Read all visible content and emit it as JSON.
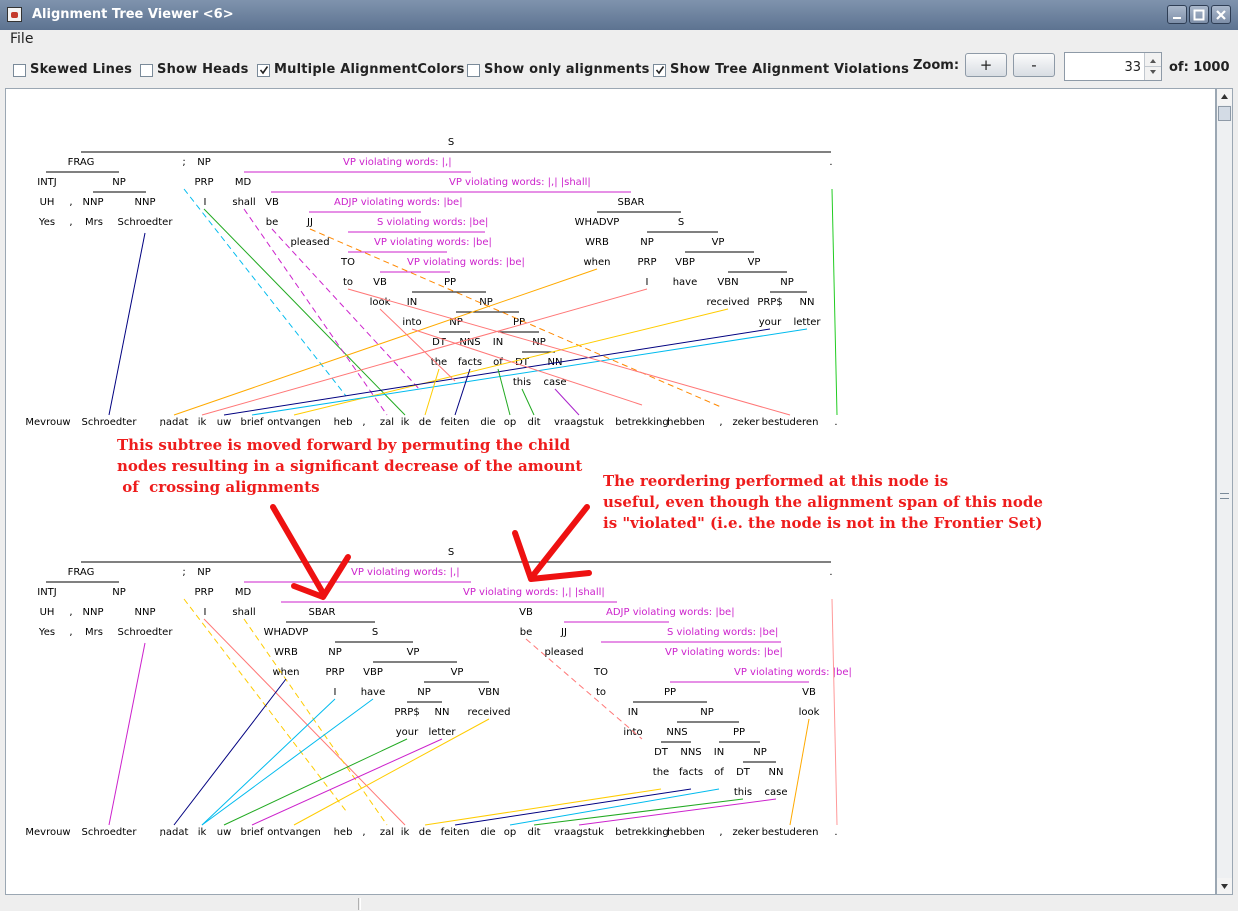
{
  "window": {
    "title": "Alignment Tree Viewer <6>"
  },
  "menu": {
    "file": "File"
  },
  "toolbar": {
    "options": [
      {
        "label": "Skewed Lines",
        "checked": false
      },
      {
        "label": "Show Heads",
        "checked": false
      },
      {
        "label": "Multiple AlignmentColors",
        "checked": true
      },
      {
        "label": "Show only alignments",
        "checked": false
      },
      {
        "label": "Show Tree Alignment Violations",
        "checked": true
      }
    ],
    "zoom_label": "Zoom:",
    "zoom_in": "+",
    "zoom_out": "-",
    "index_value": "33",
    "of_label": "of: 1000"
  },
  "colors": {
    "violation": "#cc22cc",
    "annotation": "#ee1c1c",
    "tree": "#000000"
  },
  "tree1": {
    "root": "S",
    "nodes": [
      "FRAG",
      ";",
      "NP",
      "INTJ",
      "NNP",
      "NP",
      "UH",
      ",",
      "NNP",
      "NNP",
      "PRP",
      "MD",
      "VB",
      "JJ",
      "TO",
      "VB",
      "IN",
      "DT",
      "NNS",
      "IN",
      "DT",
      "NN",
      "NP",
      "PP",
      "NP",
      "PP",
      "NP",
      "SBAR",
      "WHADVP",
      "S",
      "WRB",
      "NP",
      "VP",
      "PRP",
      "VBP",
      "VP",
      "VBN",
      "NP",
      "PRP$",
      "NN",
      "ADJP"
    ],
    "violations": [
      {
        "label": "VP",
        "text": "violating words:  |,|"
      },
      {
        "label": "VP",
        "text": "violating words:  |,| |shall|"
      },
      {
        "label": "ADJP",
        "text": "violating words:  |be|"
      },
      {
        "label": "S",
        "text": "violating words:  |be|"
      },
      {
        "label": "VP",
        "text": "violating words:  |be|"
      },
      {
        "label": "VP",
        "text": "violating words:  |be|"
      }
    ],
    "words": [
      "Yes",
      ",",
      "Mrs",
      "Schroedter",
      ";",
      "I",
      "shall",
      "be",
      "pleased",
      "to",
      "look",
      "into",
      "the",
      "facts",
      "of",
      "this",
      "case",
      "when",
      "I",
      "have",
      "received",
      "your",
      "letter",
      "."
    ]
  },
  "tree2": {
    "root": "S",
    "nodes": [
      "FRAG",
      ";",
      "NP",
      "INTJ",
      "NP",
      "UH",
      ",",
      "NNP",
      "NNP",
      "PRP",
      "MD",
      "SBAR",
      "WHADVP",
      "S",
      "WRB",
      "NP",
      "VP",
      "PRP",
      "VBP",
      "VP",
      "NP",
      "VBN",
      "PRP$",
      "NN",
      "VB",
      "ADJP",
      "JJ",
      "S",
      "TO",
      "VP",
      "PP",
      "VB",
      "IN",
      "NP",
      "DT",
      "NNS",
      "PP",
      "IN",
      "NP",
      "DT",
      "NN"
    ],
    "violations": [
      {
        "label": "VP",
        "text": "violating words:  |,|"
      },
      {
        "label": "VP",
        "text": "violating words:  |,| |shall|"
      },
      {
        "label": "ADJP",
        "text": "violating words:  |be|"
      },
      {
        "label": "S",
        "text": "violating words:  |be|"
      },
      {
        "label": "VP",
        "text": "violating words:  |be|"
      },
      {
        "label": "VP",
        "text": "violating words:  |be|"
      }
    ],
    "words": [
      "Yes",
      ",",
      "Mrs",
      "Schroedter",
      ";",
      "I",
      "shall",
      "when",
      "I",
      "have",
      "your",
      "letter",
      "received",
      "be",
      "pleased",
      "to",
      "into",
      "the",
      "facts",
      "of",
      "this",
      "case",
      "look",
      "."
    ]
  },
  "target_sentence": [
    "Mevrouw",
    "Schroedter",
    ",",
    "nadat",
    "ik",
    "uw",
    "brief",
    "ontvangen",
    "heb",
    ",",
    "zal",
    "ik",
    "de",
    "feiten",
    "die",
    "op",
    "dit",
    "vraagstuk",
    "betrekking",
    "hebben",
    ",",
    "zeker",
    "bestuderen",
    "."
  ],
  "annotations": {
    "left": "This subtree is moved forward by permuting the child\nnodes resulting in a significant decrease of the amount\n of  crossing alignments",
    "right": "The reordering performed at this node is\nuseful, even though the alignment span of this node\nis \"violated\" (i.e. the node is not in the Frontier Set)"
  }
}
